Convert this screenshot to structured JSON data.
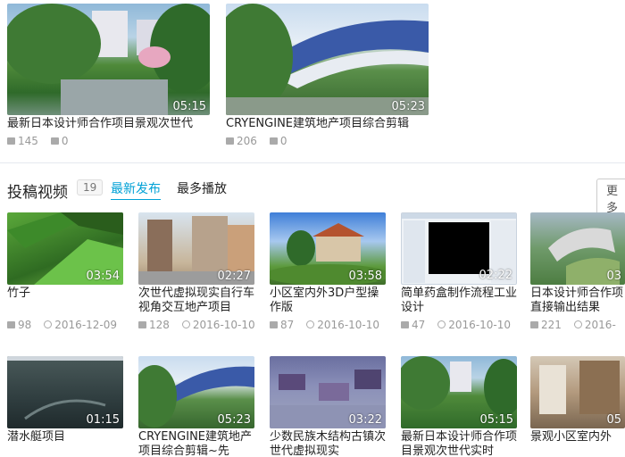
{
  "top_videos": [
    {
      "title": "最新日本设计师合作项目景观次世代",
      "duration": "05:15",
      "plays": "145",
      "comments": "0"
    },
    {
      "title": "CRYENGINE建筑地产项目综合剪辑",
      "duration": "05:23",
      "plays": "206",
      "comments": "0"
    }
  ],
  "section": {
    "title": "投稿视频",
    "count": "19",
    "tab_latest": "最新发布",
    "tab_popular": "最多播放",
    "more": "更多"
  },
  "row1": [
    {
      "title": "竹子",
      "duration": "03:54",
      "plays": "98",
      "date": "2016-12-09"
    },
    {
      "title": "次世代虚拟现实自行车视角交互地产项目",
      "duration": "02:27",
      "plays": "128",
      "date": "2016-10-10"
    },
    {
      "title": "小区室内外3D户型操作版",
      "duration": "03:58",
      "plays": "87",
      "date": "2016-10-10"
    },
    {
      "title": "简单药盒制作流程工业设计",
      "duration": "02:22",
      "plays": "47",
      "date": "2016-10-10"
    },
    {
      "title": "日本设计师合作项直接输出结果",
      "duration": "03",
      "plays": "221",
      "date": "2016-"
    }
  ],
  "row2": [
    {
      "title": "潜水艇项目",
      "duration": "01:15"
    },
    {
      "title": "CRYENGINE建筑地产项目综合剪辑~先",
      "duration": "05:23"
    },
    {
      "title": "少数民族木结构古镇次世代虚拟现实",
      "duration": "03:22"
    },
    {
      "title": "最新日本设计师合作项目景观次世代实时",
      "duration": "05:15"
    },
    {
      "title": "景观小区室内外",
      "duration": "05"
    }
  ],
  "colors": {
    "accent": "#00a1d6",
    "meta": "#999999"
  }
}
